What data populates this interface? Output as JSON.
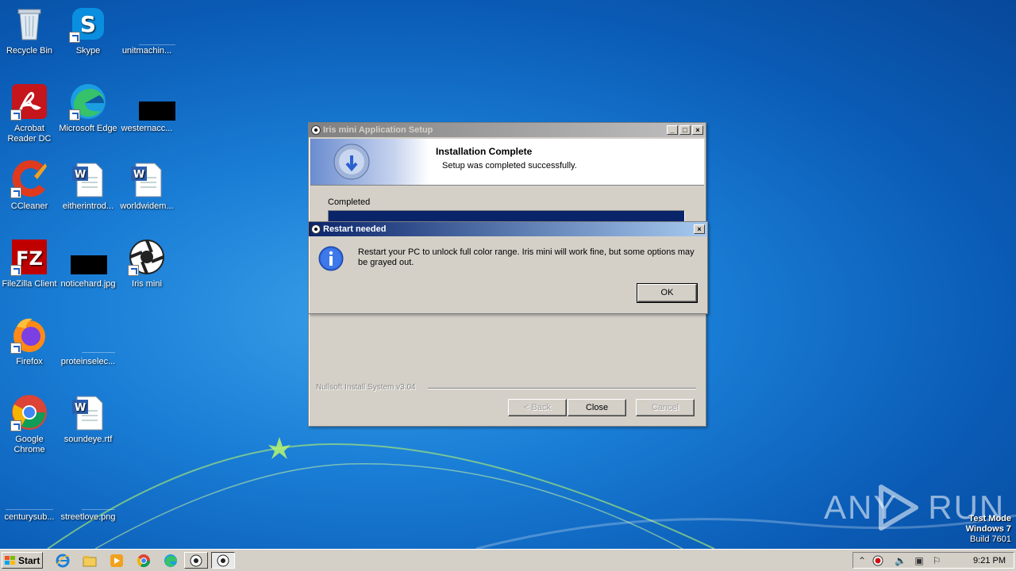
{
  "desktop": {
    "icons": [
      {
        "label": "Recycle Bin"
      },
      {
        "label": "Skype"
      },
      {
        "label": "unitmachin..."
      },
      {
        "label": "Acrobat Reader DC"
      },
      {
        "label": "Microsoft Edge"
      },
      {
        "label": "westernacc..."
      },
      {
        "label": "CCleaner"
      },
      {
        "label": "eitherintrod..."
      },
      {
        "label": "worldwidem..."
      },
      {
        "label": "FileZilla Client"
      },
      {
        "label": "noticehard.jpg"
      },
      {
        "label": "Iris mini"
      },
      {
        "label": "Firefox"
      },
      {
        "label": "proteinselec..."
      },
      {
        "label": "Google Chrome"
      },
      {
        "label": "soundeye.rtf"
      },
      {
        "label": "centurysub..."
      },
      {
        "label": "streetlove.png"
      }
    ]
  },
  "setup_window": {
    "title": "Iris mini Application Setup",
    "header_title": "Installation Complete",
    "header_subtitle": "Setup was completed successfully.",
    "status_label": "Completed",
    "progress_fraction": 1.0,
    "branding": "Nullsoft Install System v3.04",
    "back_label": "< Back",
    "close_label": "Close",
    "cancel_label": "Cancel"
  },
  "dialog": {
    "title": "Restart needed",
    "message": "Restart your PC to unlock full color range. Iris mini will work fine, but some options may be grayed out.",
    "ok_label": "OK"
  },
  "taskbar": {
    "start_label": "Start",
    "clock": "9:21 PM"
  },
  "watermark": {
    "brand": "ANY RUN",
    "line1": "Test Mode",
    "line2": "Windows 7",
    "line3": "Build 7601"
  }
}
